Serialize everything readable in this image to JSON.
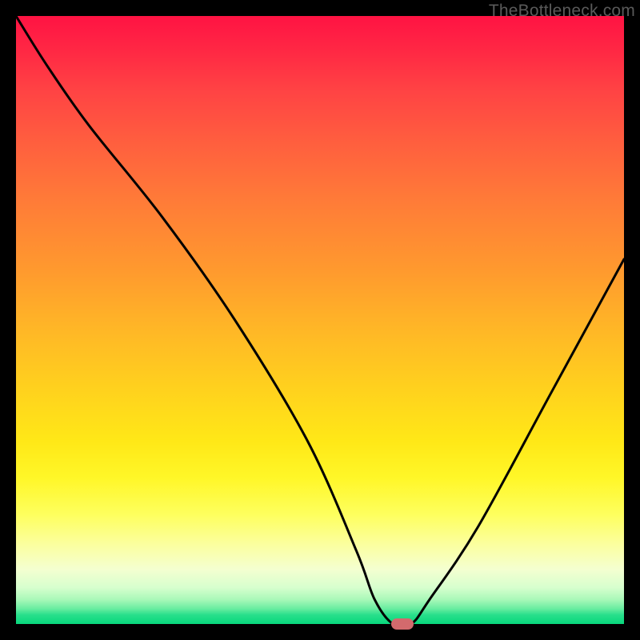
{
  "watermark": "TheBottleneck.com",
  "colors": {
    "background": "#000000",
    "curve": "#000000",
    "marker": "#d36a6d"
  },
  "chart_data": {
    "type": "line",
    "title": "",
    "xlabel": "",
    "ylabel": "",
    "xlim": [
      0,
      100
    ],
    "ylim": [
      0,
      100
    ],
    "gradient_vertical": true,
    "gradient_stops": [
      {
        "pos": 0,
        "color": "#ff1343"
      },
      {
        "pos": 50,
        "color": "#ffb525"
      },
      {
        "pos": 75,
        "color": "#fff31a"
      },
      {
        "pos": 100,
        "color": "#08d77c"
      }
    ],
    "series": [
      {
        "name": "bottleneck-curve",
        "x": [
          0,
          5,
          12,
          24,
          36,
          48,
          56,
          59,
          62,
          65,
          68,
          76,
          88,
          100
        ],
        "values": [
          100,
          92,
          82,
          67,
          50,
          30,
          12,
          4,
          0,
          0,
          4,
          16,
          38,
          60
        ]
      }
    ],
    "marker": {
      "x": 63.5,
      "y": 0,
      "width_pct": 3.7,
      "height_pct": 1.8
    }
  }
}
